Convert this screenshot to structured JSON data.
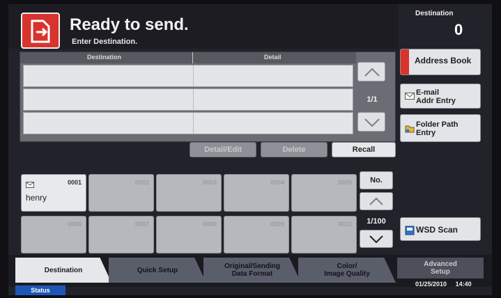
{
  "header": {
    "title": "Ready to send.",
    "subtitle": "Enter Destination.",
    "destination_label": "Destination",
    "destination_count": "0"
  },
  "table": {
    "columns": [
      "Destination",
      "Detail"
    ],
    "page": "1/1"
  },
  "actions": {
    "detail_edit": "Detail/Edit",
    "delete": "Delete",
    "recall": "Recall"
  },
  "side_buttons": {
    "address_book": "Address Book",
    "email_line1": "E-mail",
    "email_line2": "Addr Entry",
    "folder_line1": "Folder Path",
    "folder_line2": "Entry",
    "wsd_scan": "WSD Scan"
  },
  "one_touch": {
    "keys": [
      {
        "num": "0001",
        "name": "henry"
      },
      {
        "num": "0002",
        "name": ""
      },
      {
        "num": "0003",
        "name": ""
      },
      {
        "num": "0004",
        "name": ""
      },
      {
        "num": "0005",
        "name": ""
      },
      {
        "num": "0006",
        "name": ""
      },
      {
        "num": "0007",
        "name": ""
      },
      {
        "num": "0008",
        "name": ""
      },
      {
        "num": "0009",
        "name": ""
      },
      {
        "num": "0010",
        "name": ""
      }
    ],
    "no_label": "No.",
    "page": "1/100"
  },
  "tabs": {
    "destination": "Destination",
    "quick_setup": "Quick Setup",
    "original_line1": "Original/Sending",
    "original_line2": "Data Format",
    "color_line1": "Color/",
    "color_line2": "Image Quality",
    "advanced_line1": "Advanced",
    "advanced_line2": "Setup"
  },
  "status": {
    "label": "Status",
    "date": "01/25/2010",
    "time": "14:40"
  },
  "colors": {
    "accent_red": "#d8332c",
    "status_blue": "#1c57b8"
  }
}
